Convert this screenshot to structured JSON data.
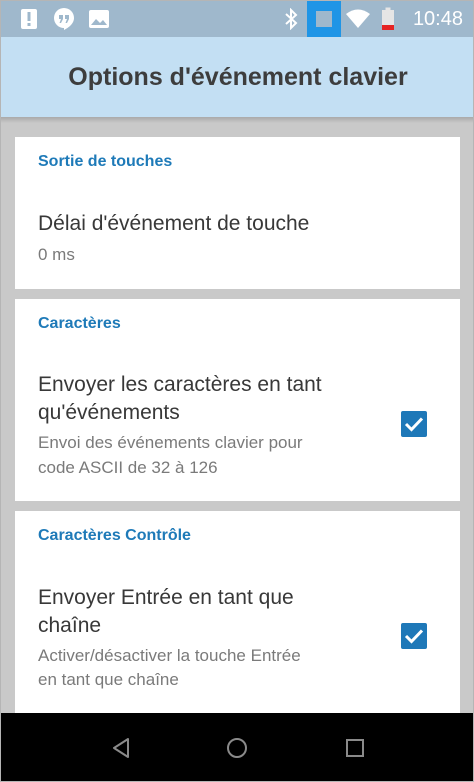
{
  "status_bar": {
    "time": "10:48",
    "left_icons": [
      "alert-icon",
      "hangouts-icon",
      "image-icon"
    ],
    "right_icons": [
      "bluetooth-icon",
      "keyboard-indicator-icon",
      "wifi-icon",
      "battery-low-icon"
    ]
  },
  "app_bar": {
    "title": "Options d'événement clavier"
  },
  "sections": [
    {
      "header": "Sortie de touches",
      "item": {
        "title": "Délai d'événement de touche",
        "summary": "0 ms"
      }
    },
    {
      "header": "Caractères",
      "item": {
        "title_line1": "Envoyer les caractères en tant",
        "title_line2": "qu'événements",
        "summary_line1": "Envoi des événements clavier pour",
        "summary_line2": "code ASCII de 32 à 126",
        "checked": true
      }
    },
    {
      "header": "Caractères Contrôle",
      "item": {
        "title_line1": "Envoyer Entrée en tant que",
        "title_line2": "chaîne",
        "summary_line1": "Activer/désactiver la touche Entrée",
        "summary_line2": "en tant que chaîne",
        "checked": true
      }
    }
  ],
  "nav_bar": {
    "buttons": [
      "back-icon",
      "home-icon",
      "recents-icon"
    ]
  },
  "colors": {
    "status_bar": "#9fb8cc",
    "app_bar": "#c3dff3",
    "accent": "#1e7ab8",
    "background": "#c9c9c9"
  }
}
